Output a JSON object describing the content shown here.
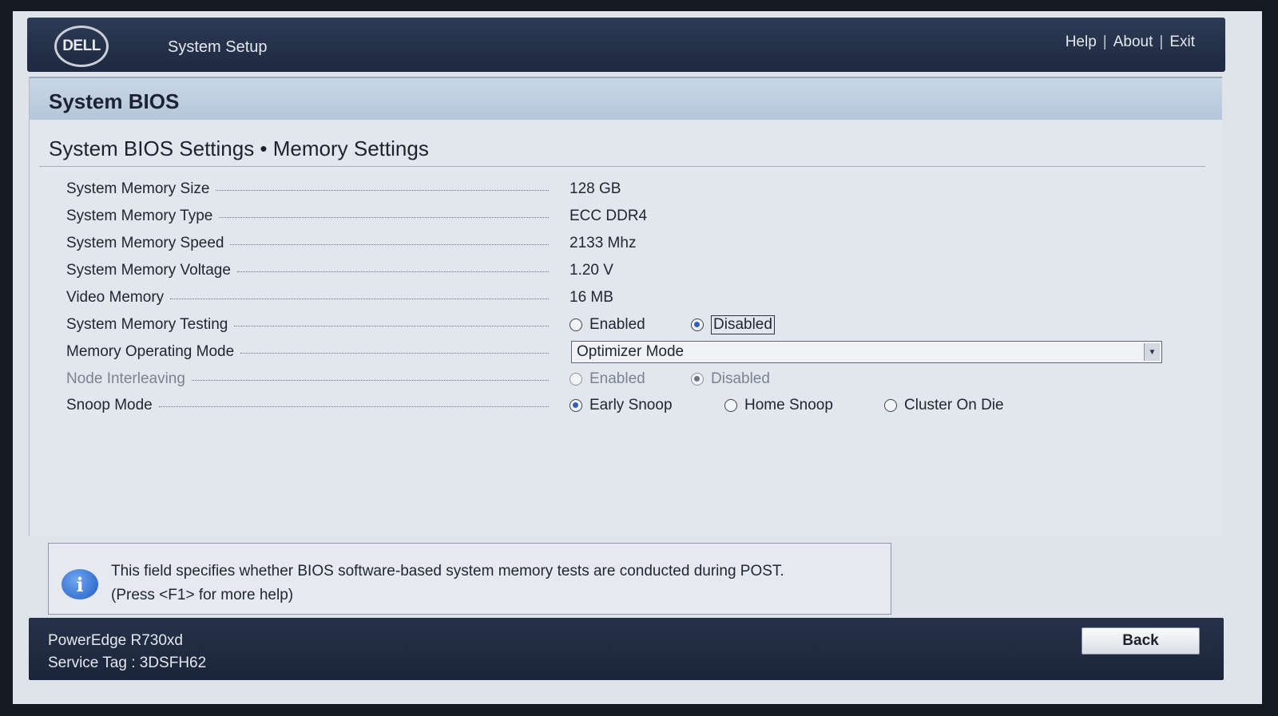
{
  "header": {
    "logo_text": "DELL",
    "app_title": "System Setup",
    "links": {
      "help": "Help",
      "about": "About",
      "exit": "Exit",
      "separator": "|"
    }
  },
  "panel": {
    "title": "System BIOS",
    "subtitle": "System BIOS Settings • Memory Settings"
  },
  "settings": {
    "memory_size": {
      "label": "System Memory Size",
      "value": "128 GB"
    },
    "memory_type": {
      "label": "System Memory Type",
      "value": "ECC DDR4"
    },
    "memory_speed": {
      "label": "System Memory Speed",
      "value": "2133 Mhz"
    },
    "memory_voltage": {
      "label": "System Memory Voltage",
      "value": "1.20 V"
    },
    "video_memory": {
      "label": "Video Memory",
      "value": "16 MB"
    },
    "memory_testing": {
      "label": "System Memory Testing",
      "options": [
        "Enabled",
        "Disabled"
      ],
      "selected": "Disabled"
    },
    "operating_mode": {
      "label": "Memory Operating Mode",
      "selected": "Optimizer Mode"
    },
    "node_interleaving": {
      "label": "Node Interleaving",
      "options": [
        "Enabled",
        "Disabled"
      ],
      "selected": "Disabled",
      "disabled": true
    },
    "snoop_mode": {
      "label": "Snoop Mode",
      "options": [
        "Early Snoop",
        "Home Snoop",
        "Cluster On Die"
      ],
      "selected": "Early Snoop"
    }
  },
  "help": {
    "line1": "This field specifies whether BIOS software-based system memory tests are conducted during POST.",
    "line2": "(Press <F1> for more help)"
  },
  "footer": {
    "model": "PowerEdge R730xd",
    "service_tag": "Service Tag : 3DSFH62",
    "back_label": "Back"
  },
  "colors": {
    "header_bg": "#1e2940",
    "panel_bg": "#e2e7ed",
    "title_bar": "#b5c6db",
    "radio_selected": "#2f5fc0"
  }
}
